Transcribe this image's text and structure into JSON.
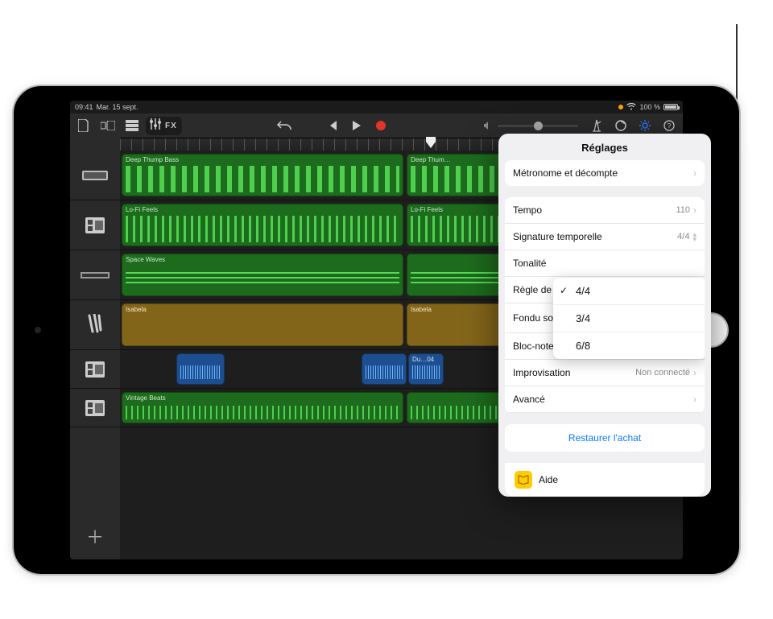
{
  "status": {
    "time_label": "Mar. 15 sept.",
    "battery": "100 %"
  },
  "toolbar": {
    "fx_label": "FX"
  },
  "tracks": [
    {
      "name": "Deep Thump Bass",
      "type": "midi-green"
    },
    {
      "name": "Lo-Fi Feels",
      "type": "midi-green"
    },
    {
      "name": "Space Waves",
      "type": "sustain-green"
    },
    {
      "name": "Isabela",
      "type": "amber"
    },
    {
      "name": "Du…04",
      "type": "blue"
    },
    {
      "name": "Vintage Beats",
      "type": "midi-green"
    }
  ],
  "popover": {
    "title": "Réglages",
    "metronome": "Métronome et décompte",
    "tempo_label": "Tempo",
    "tempo_value": "110",
    "timesig_label": "Signature temporelle",
    "timesig_value": "4/4",
    "key_label": "Tonalité",
    "ruler_label": "Règle de",
    "fadeout_label": "Fondu sortant",
    "notepad_label": "Bloc-notes",
    "jam_label": "Improvisation",
    "jam_value": "Non connecté",
    "advanced_label": "Avancé",
    "restore_label": "Restaurer l'achat",
    "help_label": "Aide"
  },
  "timesig_menu": {
    "options": [
      "4/4",
      "3/4",
      "6/8"
    ],
    "selected": "4/4"
  }
}
